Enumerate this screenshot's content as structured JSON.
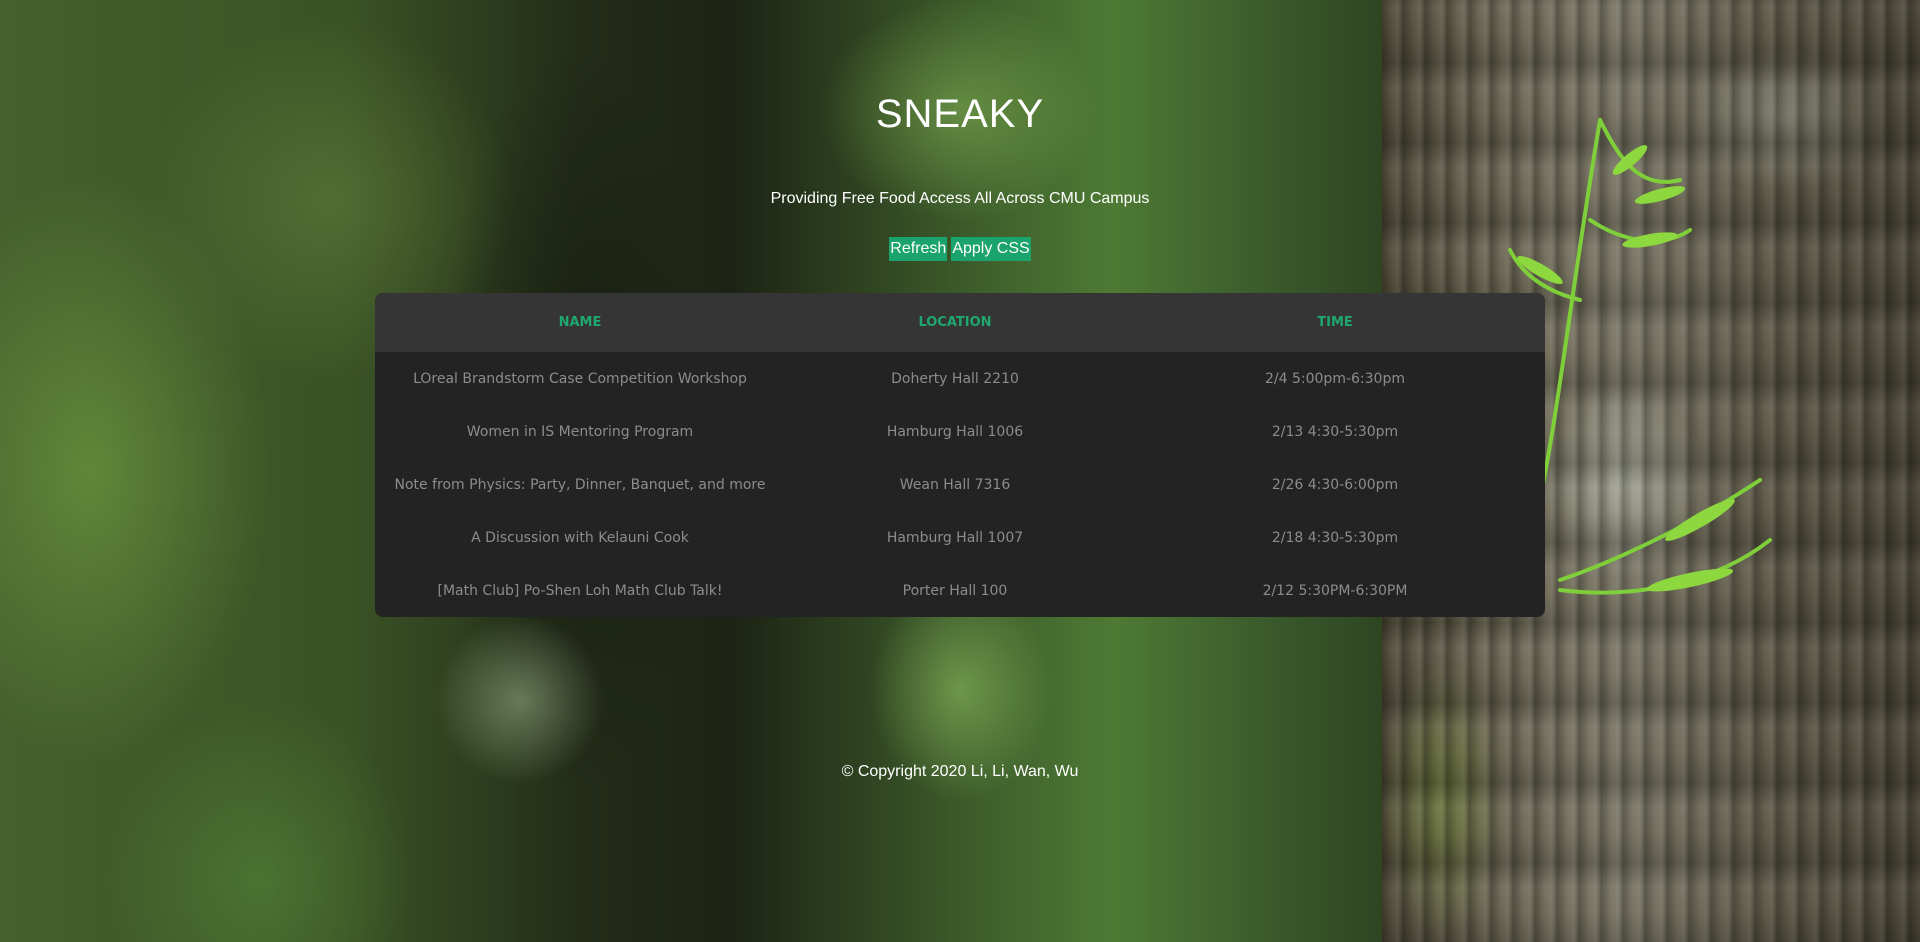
{
  "header": {
    "title": "SNEAKY",
    "tagline": "Providing Free Food Access All Across CMU Campus"
  },
  "toolbar": {
    "refresh_label": "Refresh",
    "apply_css_label": "Apply CSS"
  },
  "events_table": {
    "columns": [
      "NAME",
      "LOCATION",
      "TIME"
    ],
    "rows": [
      [
        "LOreal Brandstorm Case Competition Workshop",
        "Doherty Hall 2210",
        "2/4 5:00pm-6:30pm"
      ],
      [
        "Women in IS Mentoring Program",
        "Hamburg Hall 1006",
        "2/13 4:30-5:30pm"
      ],
      [
        "Note from Physics: Party, Dinner, Banquet, and more",
        "Wean Hall 7316",
        "2/26 4:30-6:00pm"
      ],
      [
        "A Discussion with Kelauni Cook",
        "Hamburg Hall 1007",
        "2/18 4:30-5:30pm"
      ],
      [
        "[Math Club] Po-Shen Loh Math Club Talk!",
        "Porter Hall 100",
        "2/12 5:30PM-6:30PM"
      ]
    ]
  },
  "footer": {
    "copyright": "© Copyright 2020 Li, Li, Wan, Wu"
  },
  "colors": {
    "accent": "#1aa36d",
    "header_text": "#1ea86f",
    "table_bg": "#232323",
    "table_header_bg": "#353535",
    "cell_text": "#8c8c8c"
  }
}
